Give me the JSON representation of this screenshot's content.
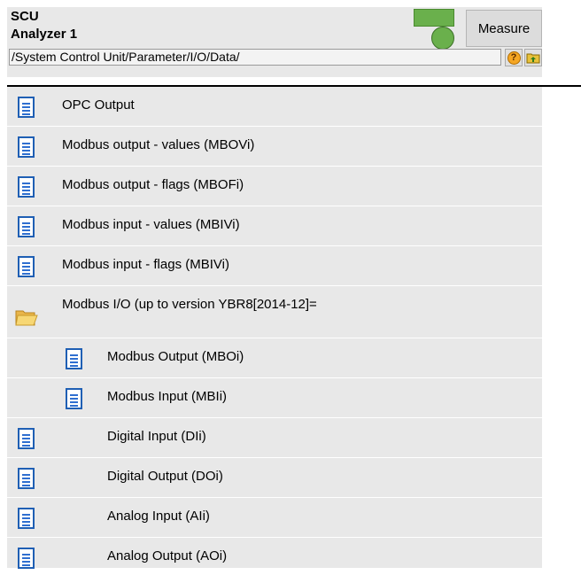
{
  "header": {
    "line1": "SCU",
    "line2": "Analyzer 1",
    "measure_label": "Measure",
    "path": "/System Control Unit/Parameter/I/O/Data/",
    "status_color": "#6ab04c"
  },
  "list": {
    "items": [
      {
        "label": "OPC Output",
        "icon": "document-icon"
      },
      {
        "label": "Modbus output - values (MBOVi)",
        "icon": "document-icon"
      },
      {
        "label": "Modbus output - flags (MBOFi)",
        "icon": "document-icon"
      },
      {
        "label": "Modbus input - values (MBIVi)",
        "icon": "document-icon"
      },
      {
        "label": "Modbus input - flags (MBIVi)",
        "icon": "document-icon"
      },
      {
        "label": "Modbus I/O (up to version YBR8[2014-12]=",
        "icon": "folder-icon"
      },
      {
        "label": "Modbus Output (MBOi)",
        "icon": "document-icon"
      },
      {
        "label": "Modbus Input (MBIi)",
        "icon": "document-icon"
      },
      {
        "label": "Digital Input (DIi)",
        "icon": "document-icon"
      },
      {
        "label": "Digital Output (DOi)",
        "icon": "document-icon"
      },
      {
        "label": "Analog Input (AIi)",
        "icon": "document-icon"
      },
      {
        "label": "Analog Output (AOi)",
        "icon": "document-icon"
      }
    ]
  }
}
